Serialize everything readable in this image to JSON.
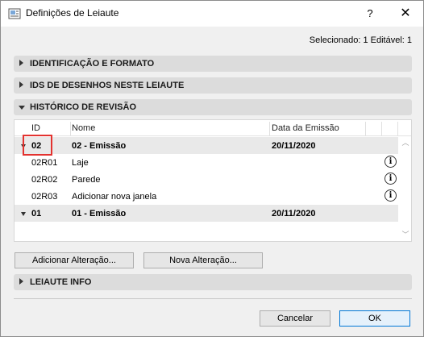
{
  "window": {
    "title": "Definições de Leiaute",
    "help": "?",
    "close": "✕"
  },
  "selection_info": "Selecionado: 1 Editável: 1",
  "sections": {
    "identification": "IDENTIFICAÇÃO E FORMATO",
    "drawing_ids": "IDS DE DESENHOS NESTE LEIAUTE",
    "revision_history": "HISTÓRICO DE REVISÃO",
    "layout_info": "LEIAUTE INFO"
  },
  "table": {
    "headers": {
      "id": "ID",
      "name": "Nome",
      "date": "Data da Emissão"
    },
    "rows": [
      {
        "id": "02",
        "name": "02 - Emissão",
        "date": "20/11/2020"
      },
      {
        "id": "02R01",
        "name": "Laje",
        "date": ""
      },
      {
        "id": "02R02",
        "name": "Parede",
        "date": ""
      },
      {
        "id": "02R03",
        "name": "Adicionar nova janela",
        "date": ""
      },
      {
        "id": "01",
        "name": "01 - Emissão",
        "date": "20/11/2020"
      }
    ],
    "info_icon": "i"
  },
  "buttons": {
    "add_change": "Adicionar Alteração...",
    "new_change": "Nova Alteração...",
    "cancel": "Cancelar",
    "ok": "OK"
  },
  "colors": {
    "highlight": "#e3322f",
    "section_bg": "#dcdcdc",
    "primary_border": "#0078d7"
  }
}
